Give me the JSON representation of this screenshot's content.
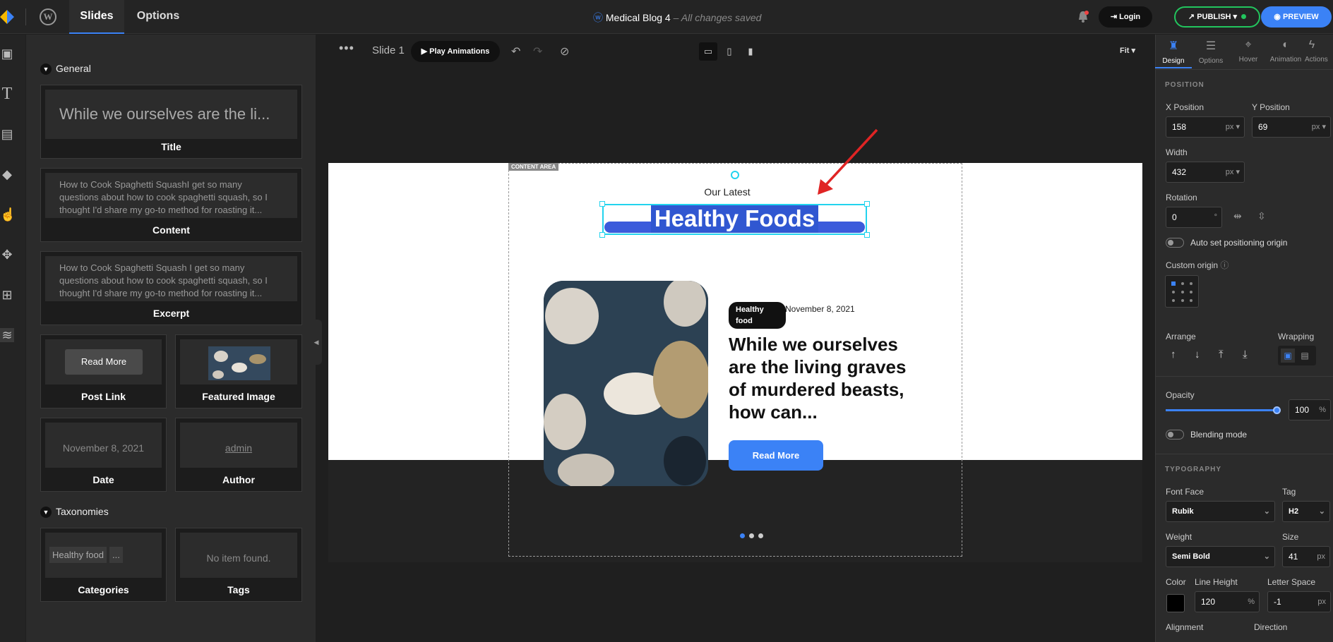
{
  "header": {
    "tabs": [
      "Slides",
      "Options"
    ],
    "doc_title": "Medical Blog 4",
    "saved_status": " – All changes saved",
    "login_label": "Login",
    "publish_label": "PUBLISH",
    "preview_label": "PREVIEW"
  },
  "left_panel": {
    "general_heading": "General",
    "title_card": {
      "preview": "While we ourselves are the li...",
      "label": "Title"
    },
    "content_card": {
      "preview": "How to Cook Spaghetti SquashI get so many questions about how to cook spaghetti squash, so I thought I'd share my go-to method for roasting it...",
      "label": "Content"
    },
    "excerpt_card": {
      "preview": "How to Cook Spaghetti Squash I get so many questions about how to cook spaghetti squash, so I thought I'd share my go-to method for roasting it...",
      "label": "Excerpt"
    },
    "postlink_card": {
      "button": "Read More",
      "label": "Post Link"
    },
    "featured_card": {
      "label": "Featured Image"
    },
    "date_card": {
      "preview": "November 8, 2021",
      "label": "Date"
    },
    "author_card": {
      "preview": "admin",
      "label": "Author"
    },
    "taxonomies_heading": "Taxonomies",
    "categories_card": {
      "pill": "Healthy food",
      "more": "...",
      "label": "Categories"
    },
    "tags_card": {
      "preview": "No item found.",
      "label": "Tags"
    }
  },
  "canvas_toolbar": {
    "slide_label": "Slide 1",
    "play_label": "Play Animations",
    "zoom": "Fit"
  },
  "canvas": {
    "content_area_label": "CONTENT AREA",
    "subheading": "Our Latest",
    "heading": "Healthy Foods",
    "badge": "Healthy food",
    "date": "November 8, 2021",
    "post_title": "While we ourselves are the living graves of murdered beasts, how can...",
    "read_more": "Read More"
  },
  "right_panel": {
    "tabs": [
      "Design",
      "Options",
      "Hover",
      "Animation",
      "Actions"
    ],
    "position_heading": "POSITION",
    "x_label": "X Position",
    "x_value": "158",
    "x_unit": "px",
    "y_label": "Y Position",
    "y_value": "69",
    "y_unit": "px",
    "width_label": "Width",
    "width_value": "432",
    "width_unit": "px",
    "rotation_label": "Rotation",
    "rotation_value": "0",
    "rotation_unit": "°",
    "auto_origin": "Auto set positioning origin",
    "custom_origin": "Custom origin",
    "arrange_label": "Arrange",
    "wrapping_label": "Wrapping",
    "opacity_label": "Opacity",
    "opacity_value": "100",
    "opacity_unit": "%",
    "blending_label": "Blending mode",
    "typography_heading": "TYPOGRAPHY",
    "font_face_label": "Font Face",
    "font_face_value": "Rubik",
    "tag_label": "Tag",
    "tag_value": "H2",
    "weight_label": "Weight",
    "weight_value": "Semi Bold",
    "size_label": "Size",
    "size_value": "41",
    "size_unit": "px",
    "color_label": "Color",
    "line_height_label": "Line Height",
    "line_height_value": "120",
    "line_height_unit": "%",
    "letter_space_label": "Letter Space",
    "letter_space_value": "-1",
    "letter_space_unit": "px",
    "alignment_label": "Alignment",
    "direction_label": "Direction"
  },
  "colors": {
    "accent": "#3b82f6",
    "publish": "#22c55e",
    "selection": "#22d3ee",
    "annotation_arrow": "#e02424"
  }
}
